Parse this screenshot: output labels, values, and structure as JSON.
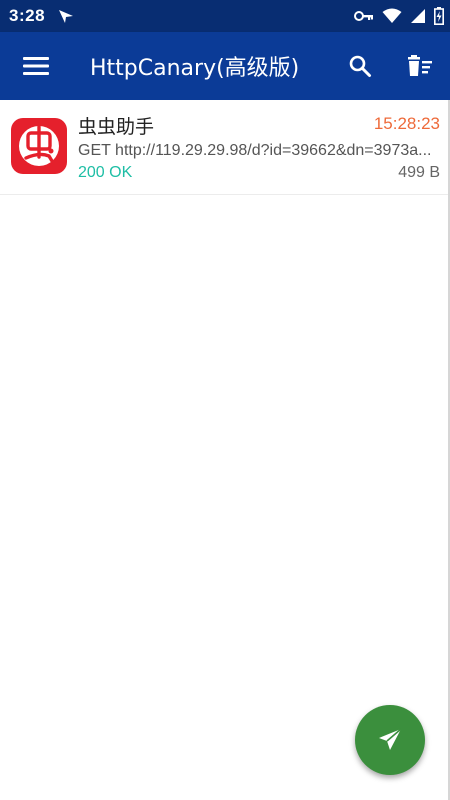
{
  "status_bar": {
    "time": "3:28",
    "icons": [
      "navigation-arrow-icon",
      "vpn-key-icon",
      "wifi-icon",
      "cellular-signal-icon",
      "battery-charging-icon"
    ],
    "color": "#082d72"
  },
  "app_bar": {
    "title": "HttpCanary(高级版)",
    "menu_icon": "hamburger-menu-icon",
    "search_icon": "search-icon",
    "clear_icon": "clear-all-icon",
    "color": "#0b3b97"
  },
  "requests": [
    {
      "app_name": "虫虫助手",
      "app_icon": "chongchong-app-icon",
      "time": "15:28:23",
      "url": "GET http://119.29.29.98/d?id=39662&dn=3973a...",
      "status": "200 OK",
      "size": "499 B"
    }
  ],
  "fab": {
    "icon": "send-icon",
    "color": "#3b8f3d"
  },
  "colors": {
    "time_accent": "#ee6a3a",
    "status_ok": "#1ebea5",
    "app_icon_red": "#e5202c"
  }
}
